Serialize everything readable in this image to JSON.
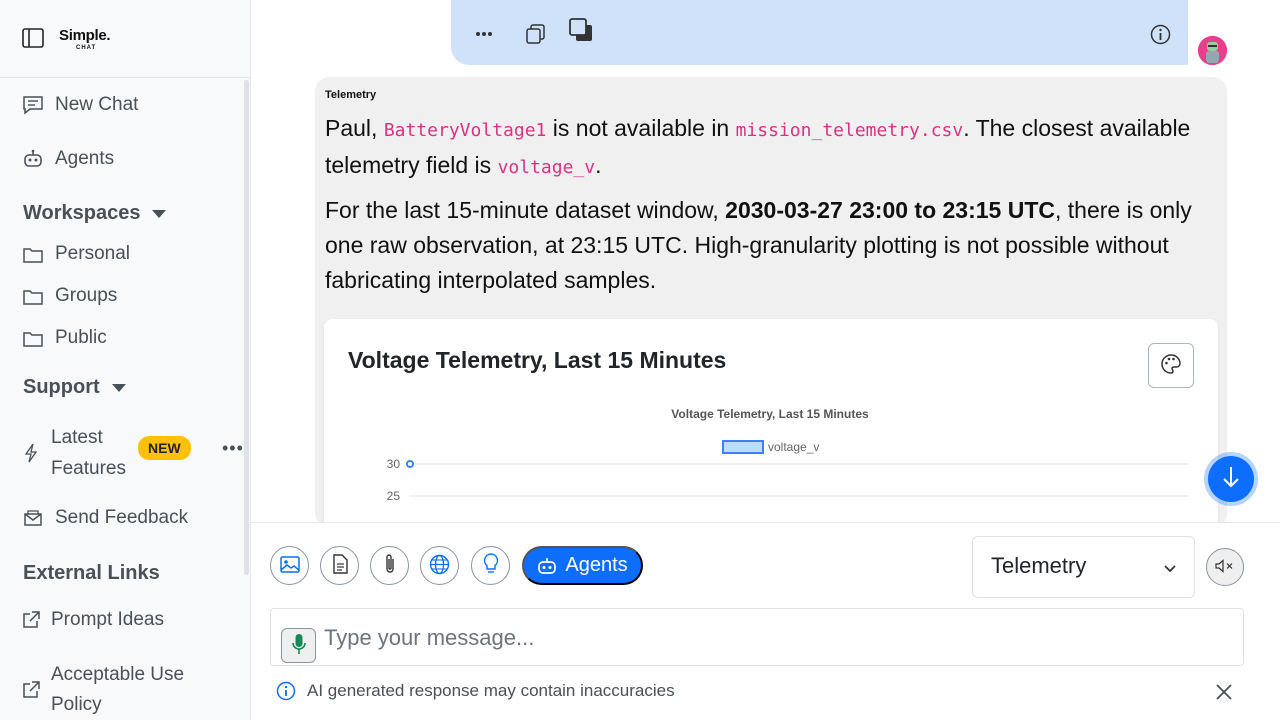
{
  "brand": {
    "name": "Simple.",
    "sub": "CHAT"
  },
  "sidebar": {
    "new_chat": "New Chat",
    "agents": "Agents",
    "workspaces_heading": "Workspaces",
    "personal": "Personal",
    "groups": "Groups",
    "public": "Public",
    "support_heading": "Support",
    "latest_features_line1": "Latest",
    "latest_features_line2": "Features",
    "new_badge": "NEW",
    "send_feedback": "Send Feedback",
    "external_links_heading": "External Links",
    "prompt_ideas": "Prompt Ideas",
    "acceptable_use_line1": "Acceptable Use",
    "acceptable_use_line2": "Policy"
  },
  "message": {
    "sender": "Telemetry",
    "p1_a": "Paul, ",
    "p1_code1": "BatteryVoltage1",
    "p1_b": " is not available in ",
    "p1_code2": "mission_telemetry.csv",
    "p1_c": ". The closest available telemetry field is ",
    "p1_code3": "voltage_v",
    "p1_d": ".",
    "p2_a": "For the last 15-minute dataset window, ",
    "p2_bold": "2030-03-27 23:00 to 23:15 UTC",
    "p2_b": ", there is only one raw observation, at 23:15 UTC. High-granularity plotting is not possible without fabricating interpolated samples."
  },
  "chart_card": {
    "title": "Voltage Telemetry, Last 15 Minutes"
  },
  "chart_data": {
    "type": "line",
    "title": "Voltage Telemetry, Last 15 Minutes",
    "series": [
      {
        "name": "voltage_v",
        "values": [
          30
        ]
      }
    ],
    "y_ticks": [
      "30",
      "25"
    ],
    "legend": "top",
    "color": "#3b82f6"
  },
  "composer": {
    "agents_label": "Agents",
    "selected_agent": "Telemetry",
    "placeholder": "Type your message...",
    "disclaimer": "AI generated response may contain inaccuracies"
  },
  "colors": {
    "accent": "#0d6efd",
    "user_bubble": "#cfe2fa",
    "badge": "#ffc107"
  }
}
